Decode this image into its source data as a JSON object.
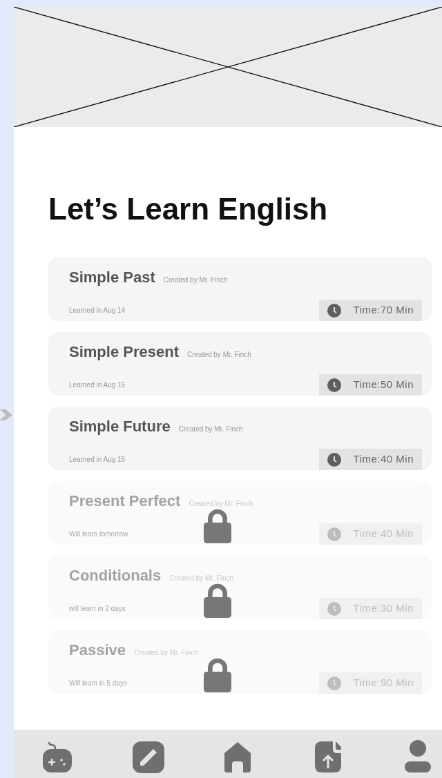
{
  "title": "Let’s Learn English",
  "lessons": [
    {
      "name": "Simple Past",
      "author": "Created by Mr. Finch",
      "note": "Learned in Aug 14",
      "time": "Time:70 Min",
      "locked": false
    },
    {
      "name": "Simple Present",
      "author": "Created by Mr. Finch",
      "note": "Learned in Aug 15",
      "time": "Time:50 Min",
      "locked": false
    },
    {
      "name": "Simple Future",
      "author": "Created by Mr. Finch",
      "note": "Learned in Aug 15",
      "time": "Time:40 Min",
      "locked": false
    },
    {
      "name": "Present Perfect",
      "author": "Created by Mr. Finch",
      "note": "Will learn tomorrow",
      "time": "Time:40 Min",
      "locked": true
    },
    {
      "name": "Conditionals",
      "author": "Created by Mr. Finch",
      "note": "will learn in 2 days",
      "time": "Time:30 Min",
      "locked": true
    },
    {
      "name": "Passive",
      "author": "Created by Mr. Finch",
      "note": "Will learn in 5 days",
      "time": "Time:90 Min",
      "locked": true
    }
  ],
  "nav": [
    {
      "kind": "gamepad",
      "selected": false
    },
    {
      "kind": "pencil",
      "selected": false
    },
    {
      "kind": "home",
      "selected": false
    },
    {
      "kind": "upload",
      "selected": false
    },
    {
      "kind": "person",
      "selected": false
    }
  ]
}
